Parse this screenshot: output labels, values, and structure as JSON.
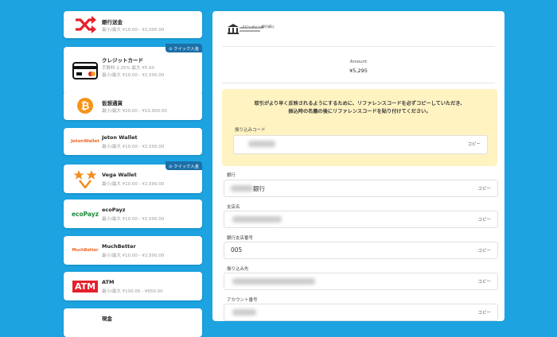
{
  "methods": [
    {
      "title": "銀行送金",
      "lines": [
        "最小/最大 ¥10.00 - ¥2,000.00"
      ],
      "icon": "shuffle-icon"
    },
    {
      "title": "クレジットカード",
      "lines": [
        "手数料 2.25% 最大 ¥5.00",
        "最小/最大 ¥10.00 - ¥2,500.00"
      ],
      "badge": "クイック入金",
      "icon": "credit-card-icon"
    },
    {
      "title": "仮想通貨",
      "lines": [
        "最小/最大 ¥20.00 - ¥10,000.00"
      ],
      "icon": "bitcoin-icon"
    },
    {
      "title": "Jeton Wallet",
      "lines": [
        "最小/最大 ¥10.00 - ¥2,500.00"
      ],
      "icon": "jeton-logo",
      "logo_text": "JetonWallet"
    },
    {
      "title": "Vega Wallet",
      "lines": [
        "最小/最大 ¥10.00 - ¥2,500.00"
      ],
      "badge": "クイック入金",
      "icon": "vega-wallet-logo"
    },
    {
      "title": "ecoPayz",
      "lines": [
        "最小/最大 ¥10.00 - ¥2,500.00"
      ],
      "icon": "ecopayz-logo",
      "logo_text": "ecoPayz"
    },
    {
      "title": "MuchBetter",
      "lines": [
        "最小/最大 ¥10.00 - ¥2,500.00"
      ],
      "icon": "muchbetter-logo",
      "logo_text": "MuchBetter"
    },
    {
      "title": "ATM",
      "lines": [
        "最小/最大 ¥100.00 - ¥650.00"
      ],
      "icon": "atm-logo",
      "logo_text": "ATM"
    },
    {
      "title": "現金",
      "lines": [],
      "icon": "cash-icon"
    }
  ],
  "detail": {
    "brand": "スピーディー銀行振込",
    "amount_label": "Amount",
    "amount_value": "¥5,295",
    "notice_line1": "取引がより早く反映されるようにするために、リファレンスコードを必ずコピーしていただき、",
    "notice_line2": "振込時の名義の後にリファレンスコードを貼り付けてください。",
    "reference_label": "振り込みコード",
    "copy_label": "コピー",
    "fields": [
      {
        "label": "銀行",
        "value": "銀行"
      },
      {
        "label": "支店名",
        "value": ""
      },
      {
        "label": "銀行支店番号",
        "value": "005"
      },
      {
        "label": "振り込み先",
        "value": ""
      },
      {
        "label": "アカウント番号",
        "value": ""
      }
    ]
  },
  "colors": {
    "background": "#1ca3e0",
    "badge": "#1c6fa8",
    "notice": "#fff3c2",
    "shuffle": "#e4212b"
  }
}
